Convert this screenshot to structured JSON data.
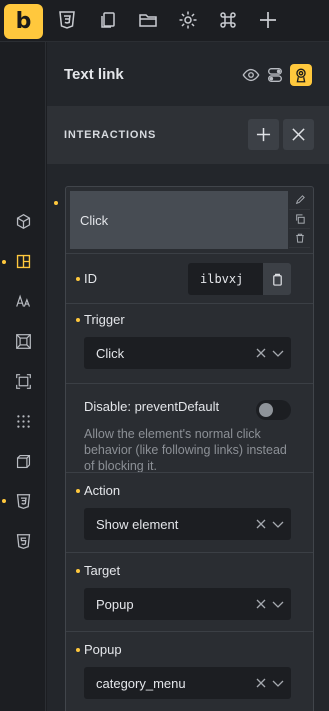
{
  "topbar": {
    "logo_letter": "b",
    "icons": [
      "css3-icon",
      "pages-icon",
      "folder-icon",
      "settings-icon",
      "command-icon",
      "add-icon"
    ]
  },
  "sidebar_icons": [
    "cube-icon",
    "layout-icon",
    "typography-icon",
    "spacing-icon",
    "sizing-icon",
    "grid-dots-icon",
    "3d-box-icon",
    "css3-icon",
    "html5-icon"
  ],
  "panel": {
    "title": "Text link",
    "section_title": "INTERACTIONS"
  },
  "interaction": {
    "card_label": "Click",
    "id_label": "ID",
    "id_value": "ilbvxj",
    "trigger_label": "Trigger",
    "trigger_value": "Click",
    "disable_label": "Disable: preventDefault",
    "disable_help": "Allow the element's normal click behavior (like following links) instead of blocking it.",
    "disable_enabled": false,
    "action_label": "Action",
    "action_value": "Show element",
    "target_label": "Target",
    "target_value": "Popup",
    "popup_label": "Popup",
    "popup_value": "category_menu"
  },
  "colors": {
    "accent": "#ffc83d",
    "background": "#1c1e22",
    "panel": "#23262b"
  }
}
